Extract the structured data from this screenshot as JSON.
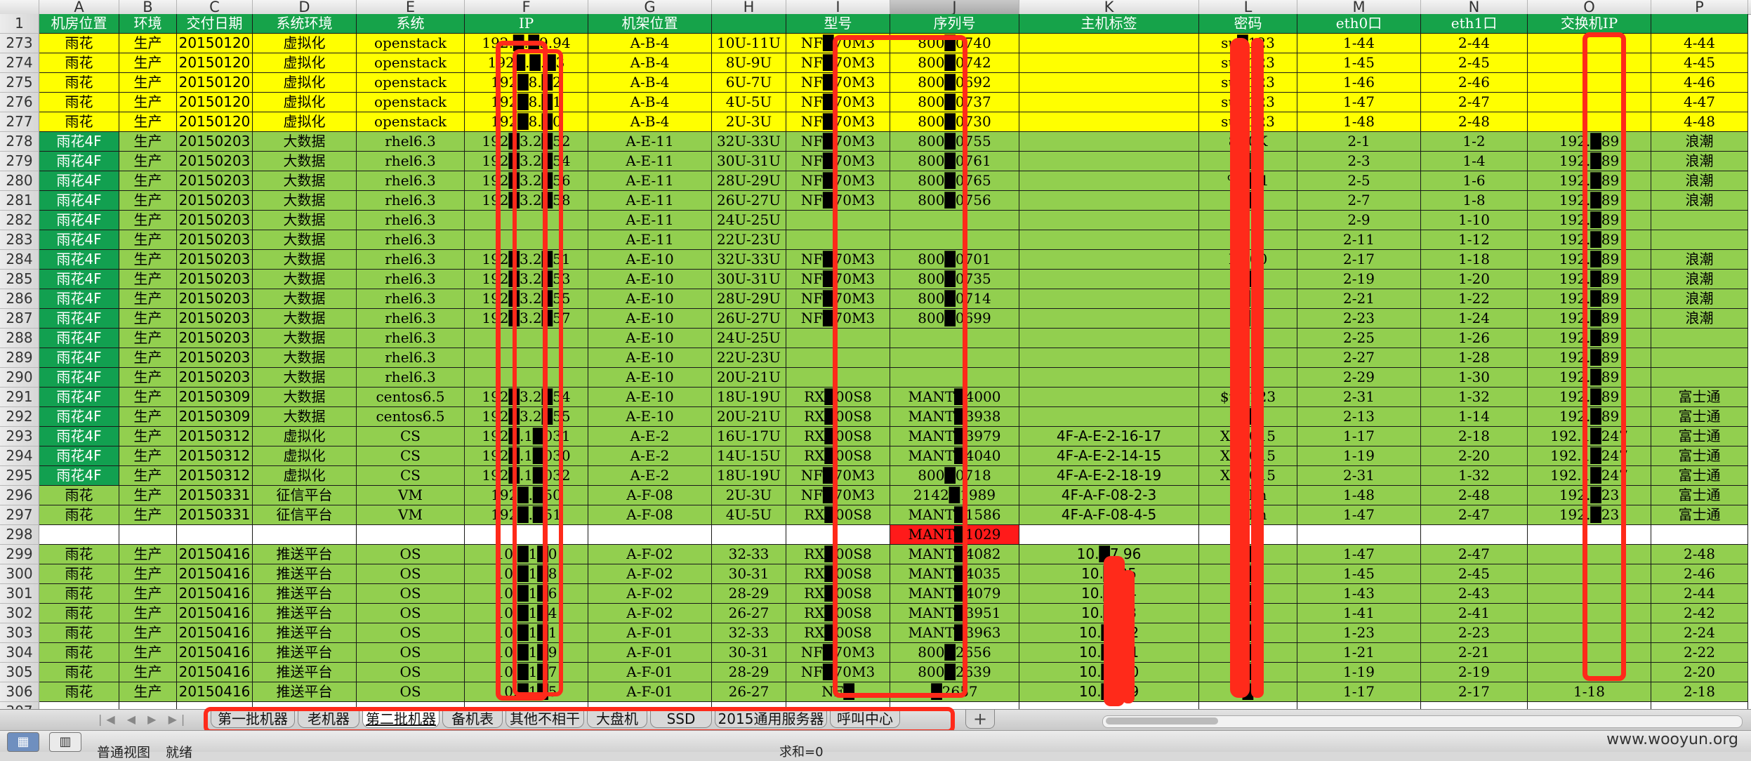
{
  "columns": [
    {
      "letter": "",
      "w": 56
    },
    {
      "letter": "A",
      "w": 114
    },
    {
      "letter": "B",
      "w": 82
    },
    {
      "letter": "C",
      "w": 108
    },
    {
      "letter": "D",
      "w": 148
    },
    {
      "letter": "E",
      "w": 154
    },
    {
      "letter": "F",
      "w": 176
    },
    {
      "letter": "G",
      "w": 176
    },
    {
      "letter": "H",
      "w": 106
    },
    {
      "letter": "I",
      "w": 148
    },
    {
      "letter": "J",
      "w": 184
    },
    {
      "letter": "K",
      "w": 256
    },
    {
      "letter": "L",
      "w": 140
    },
    {
      "letter": "M",
      "w": 176
    },
    {
      "letter": "N",
      "w": 152
    },
    {
      "letter": "O",
      "w": 176
    },
    {
      "letter": "P",
      "w": 138
    }
  ],
  "selected_column": "J",
  "rows": [
    {
      "n": "1",
      "style": "hdr",
      "cells": [
        "机房位置",
        "环境",
        "交付日期",
        "系统环境",
        "系统",
        "IP",
        "机架位置",
        "",
        "型号",
        "序列号",
        "主机标签",
        "密码",
        "eth0口",
        "eth1口",
        "交换机IP",
        ""
      ]
    },
    {
      "n": "273",
      "style": "yellow",
      "cells": [
        "雨花",
        "生产",
        "20150120",
        "虚拟化",
        "openstack",
        "192.█.█9.94",
        "A-B-4",
        "10U-11U",
        "NF█70M3",
        "800█0740",
        "",
        "su█123",
        "1-44",
        "2-44",
        "",
        "4-44"
      ]
    },
    {
      "n": "274",
      "style": "yellow",
      "cells": [
        "雨花",
        "生产",
        "20150120",
        "虚拟化",
        "openstack",
        "192█.█.█3",
        "A-B-4",
        "8U-9U",
        "NF█70M3",
        "800█0742",
        "",
        "su█123",
        "1-45",
        "2-45",
        "",
        "4-45"
      ]
    },
    {
      "n": "275",
      "style": "yellow",
      "cells": [
        "雨花",
        "生产",
        "20150120",
        "虚拟化",
        "openstack",
        "192█8.█2",
        "A-B-4",
        "6U-7U",
        "NF█70M3",
        "800█0692",
        "",
        "su█123",
        "1-46",
        "2-46",
        "",
        "4-46"
      ]
    },
    {
      "n": "276",
      "style": "yellow",
      "cells": [
        "雨花",
        "生产",
        "20150120",
        "虚拟化",
        "openstack",
        "192█8.█1",
        "A-B-4",
        "4U-5U",
        "NF█70M3",
        "800█0737",
        "",
        "su█123",
        "1-47",
        "2-47",
        "",
        "4-47"
      ]
    },
    {
      "n": "277",
      "style": "yellow",
      "cells": [
        "雨花",
        "生产",
        "20150120",
        "虚拟化",
        "openstack",
        "192█8.█0",
        "A-B-4",
        "2U-3U",
        "NF█70M3",
        "800█0730",
        "",
        "su█123",
        "1-48",
        "2-48",
        "",
        "4-48"
      ]
    },
    {
      "n": "278",
      "style": "green",
      "a": "dark",
      "cells": [
        "雨花4F",
        "生产",
        "20150203",
        "大数据",
        "rhel6.3",
        "192█3.2█52",
        "A-E-11",
        "32U-33U",
        "NF█70M3",
        "800█0755",
        "",
        "8█0K",
        "2-1",
        "1-2",
        "192.█89",
        "浪潮"
      ]
    },
    {
      "n": "279",
      "style": "green",
      "a": "dark",
      "cells": [
        "雨花4F",
        "生产",
        "20150203",
        "大数据",
        "rhel6.3",
        "192█3.2█54",
        "A-E-11",
        "30U-31U",
        "NF█70M3",
        "800█0761",
        "",
        ",█F",
        "2-3",
        "1-4",
        "192.█89",
        "浪潮"
      ]
    },
    {
      "n": "280",
      "style": "green",
      "a": "dark",
      "cells": [
        "雨花4F",
        "生产",
        "20150203",
        "大数据",
        "rhel6.3",
        "192█3.2█56",
        "A-E-11",
        "28U-29U",
        "NF█70M3",
        "800█0765",
        "",
        "%█01",
        "2-5",
        "1-6",
        "192.█89",
        "浪潮"
      ]
    },
    {
      "n": "281",
      "style": "green",
      "a": "dark",
      "cells": [
        "雨花4F",
        "生产",
        "20150203",
        "大数据",
        "rhel6.3",
        "192█3.2█58",
        "A-E-11",
        "26U-27U",
        "NF█70M3",
        "800█0756",
        "",
        "n█4",
        "2-7",
        "1-8",
        "192.█89",
        "浪潮"
      ]
    },
    {
      "n": "282",
      "style": "green",
      "a": "dark",
      "cells": [
        "雨花4F",
        "生产",
        "20150203",
        "大数据",
        "rhel6.3",
        "",
        "A-E-11",
        "24U-25U",
        "",
        "",
        "",
        "",
        "2-9",
        "1-10",
        "192.█89",
        ""
      ]
    },
    {
      "n": "283",
      "style": "green",
      "a": "dark",
      "cells": [
        "雨花4F",
        "生产",
        "20150203",
        "大数据",
        "rhel6.3",
        "",
        "A-E-11",
        "22U-23U",
        "",
        "",
        "",
        "",
        "2-11",
        "1-12",
        "192.█89",
        ""
      ]
    },
    {
      "n": "284",
      "style": "green",
      "a": "dark",
      "cells": [
        "雨花4F",
        "生产",
        "20150203",
        "大数据",
        "rhel6.3",
        "192█3.2█51",
        "A-E-10",
        "32U-33U",
        "NF█70M3",
        "800█0701",
        "",
        "E█00",
        "2-17",
        "1-18",
        "192.█89",
        "浪潮"
      ]
    },
    {
      "n": "285",
      "style": "green",
      "a": "dark",
      "cells": [
        "雨花4F",
        "生产",
        "20150203",
        "大数据",
        "rhel6.3",
        "192█3.2█53",
        "A-E-10",
        "30U-31U",
        "NF█70M3",
        "800█0735",
        "",
        "k█E",
        "2-19",
        "1-20",
        "192.█89",
        "浪潮"
      ]
    },
    {
      "n": "286",
      "style": "green",
      "a": "dark",
      "cells": [
        "雨花4F",
        "生产",
        "20150203",
        "大数据",
        "rhel6.3",
        "192█3.2█55",
        "A-E-10",
        "28U-29U",
        "NF█70M3",
        "800█0714",
        "",
        "(█~",
        "2-21",
        "1-22",
        "192.█89",
        "浪潮"
      ]
    },
    {
      "n": "287",
      "style": "green",
      "a": "dark",
      "cells": [
        "雨花4F",
        "生产",
        "20150203",
        "大数据",
        "rhel6.3",
        "192█3.2█57",
        "A-E-10",
        "26U-27U",
        "NF█70M3",
        "800█0699",
        "",
        ")█>",
        "2-23",
        "1-24",
        "192.█89",
        "浪潮"
      ]
    },
    {
      "n": "288",
      "style": "green",
      "a": "dark",
      "cells": [
        "雨花4F",
        "生产",
        "20150203",
        "大数据",
        "rhel6.3",
        "",
        "A-E-10",
        "24U-25U",
        "",
        "",
        "",
        "",
        "2-25",
        "1-26",
        "192.█89",
        ""
      ]
    },
    {
      "n": "289",
      "style": "green",
      "a": "dark",
      "cells": [
        "雨花4F",
        "生产",
        "20150203",
        "大数据",
        "rhel6.3",
        "",
        "A-E-10",
        "22U-23U",
        "",
        "",
        "",
        "",
        "2-27",
        "1-28",
        "192.█89",
        ""
      ]
    },
    {
      "n": "290",
      "style": "green",
      "a": "dark",
      "cells": [
        "雨花4F",
        "生产",
        "20150203",
        "大数据",
        "rhel6.3",
        "",
        "A-E-10",
        "20U-21U",
        "",
        "",
        "",
        "",
        "2-29",
        "1-30",
        "192.█89",
        ""
      ]
    },
    {
      "n": "291",
      "style": "green",
      "a": "dark",
      "cells": [
        "雨花4F",
        "生产",
        "20150309",
        "大数据",
        "centos6.5",
        "192█3.2█54",
        "A-E-10",
        "18U-19U",
        "RX█00S8",
        "MANT█4000",
        "",
        "$u█123",
        "2-31",
        "1-32",
        "192.█89",
        "富士通"
      ]
    },
    {
      "n": "292",
      "style": "green",
      "a": "dark",
      "cells": [
        "雨花4F",
        "生产",
        "20150309",
        "大数据",
        "centos6.5",
        "192█3.2█55",
        "A-E-10",
        "20U-21U",
        "RX█00S8",
        "MANT█3938",
        "",
        "9█9",
        "2-13",
        "1-14",
        "192.█89",
        "富士通"
      ]
    },
    {
      "n": "293",
      "style": "green",
      "a": "dark",
      "cells": [
        "雨花4F",
        "生产",
        "20150312",
        "虚拟化",
        "CS",
        "192█.1█031",
        "A-E-2",
        "16U-17U",
        "RX█00S8",
        "MANT█3979",
        "4F-A-E-2-16-17",
        "Xx█015",
        "1-17",
        "2-18",
        "192.1█247",
        "富士通"
      ]
    },
    {
      "n": "294",
      "style": "green",
      "a": "dark",
      "cells": [
        "雨花4F",
        "生产",
        "20150312",
        "虚拟化",
        "CS",
        "192█.1█030",
        "A-E-2",
        "14U-15U",
        "RX█00S8",
        "MANT█4040",
        "4F-A-E-2-14-15",
        "Xx█015",
        "1-19",
        "2-20",
        "192.1█247",
        "富士通"
      ]
    },
    {
      "n": "295",
      "style": "green",
      "a": "dark",
      "cells": [
        "雨花4F",
        "生产",
        "20150312",
        "虚拟化",
        "CS",
        "192█.1█032",
        "A-E-2",
        "18U-19U",
        "NF█70M3",
        "800█0718",
        "4F-A-E-2-18-19",
        "Xx█015",
        "2-31",
        "1-32",
        "192.1█247",
        "富士通"
      ]
    },
    {
      "n": "296",
      "style": "green",
      "cells": [
        "雨花",
        "生产",
        "20150331",
        "征信平台",
        "VM",
        "192█.█50",
        "A-F-08",
        "2U-3U",
        "NF█70M3",
        "2142█1989",
        "4F-A-F-08-2-3",
        "1█hn",
        "1-48",
        "2-48",
        "192.█23",
        "富士通"
      ]
    },
    {
      "n": "297",
      "style": "green",
      "cells": [
        "雨花",
        "生产",
        "20150331",
        "征信平台",
        "VM",
        "192█.█51",
        "A-F-08",
        "4U-5U",
        "RX█00S8",
        "MANT█1586",
        "4F-A-F-08-4-5",
        "1█hn",
        "1-47",
        "2-47",
        "192.█23",
        "富士通"
      ]
    },
    {
      "n": "298",
      "style": "white",
      "cells": [
        "",
        "",
        "",
        "",
        "",
        "",
        "",
        "",
        "",
        "MANT█1029",
        "",
        "",
        "",
        "",
        "",
        ""
      ]
    },
    {
      "n": "299",
      "style": "green",
      "cells": [
        "雨花",
        "生产",
        "20150416",
        "推送平台",
        "OS",
        "10.█1█0",
        "A-F-02",
        "32-33",
        "RX█00S8",
        "MANT█4082",
        "10.█7.96",
        "4█b",
        "1-47",
        "2-47",
        "",
        "2-48"
      ]
    },
    {
      "n": "300",
      "style": "green",
      "cells": [
        "雨花",
        "生产",
        "20150416",
        "推送平台",
        "OS",
        "10.█1█8",
        "A-F-02",
        "30-31",
        "RX█00S8",
        "MANT█4035",
        "10.█.95",
        "4█b",
        "1-45",
        "2-45",
        "",
        "2-46"
      ]
    },
    {
      "n": "301",
      "style": "green",
      "cells": [
        "雨花",
        "生产",
        "20150416",
        "推送平台",
        "OS",
        "10.█1█6",
        "A-F-02",
        "28-29",
        "RX█00S8",
        "MANT█4079",
        "10.█.94",
        "4█b",
        "1-43",
        "2-43",
        "",
        "2-44"
      ]
    },
    {
      "n": "302",
      "style": "green",
      "cells": [
        "雨花",
        "生产",
        "20150416",
        "推送平台",
        "OS",
        "10.█1█4",
        "A-F-02",
        "26-27",
        "RX█00S8",
        "MANT█3951",
        "10.█.93",
        "4█b",
        "1-41",
        "2-41",
        "",
        "2-42"
      ]
    },
    {
      "n": "303",
      "style": "green",
      "cells": [
        "雨花",
        "生产",
        "20150416",
        "推送平台",
        "OS",
        "10.█1█1",
        "A-F-01",
        "32-33",
        "RX█00S8",
        "MANT█3963",
        "10.█112",
        "4█b",
        "1-23",
        "2-23",
        "",
        "2-24"
      ]
    },
    {
      "n": "304",
      "style": "green",
      "cells": [
        "雨花",
        "生产",
        "20150416",
        "推送平台",
        "OS",
        "10.█1█9",
        "A-F-01",
        "30-31",
        "NF█70M3",
        "800█2656",
        "10.█111",
        "4█b",
        "1-21",
        "2-21",
        "",
        "2-22"
      ]
    },
    {
      "n": "305",
      "style": "green",
      "cells": [
        "雨花",
        "生产",
        "20150416",
        "推送平台",
        "OS",
        "10.█1█7",
        "A-F-01",
        "28-29",
        "NF█70M3",
        "800█2639",
        "10.█110",
        "4█b",
        "1-19",
        "2-19",
        "",
        "2-20"
      ]
    },
    {
      "n": "306",
      "style": "green",
      "cells": [
        "雨花",
        "生产",
        "20150416",
        "推送平台",
        "OS",
        "10.█1█5",
        "A-F-01",
        "26-27",
        "NF█",
        "█2657",
        "10.█109",
        "4█b",
        "1-17",
        "2-17",
        "1-18",
        "2-18"
      ]
    },
    {
      "n": "307",
      "style": "white",
      "cells": [
        "",
        "",
        "",
        "",
        "",
        "",
        "",
        "",
        "",
        "",
        "",
        "",
        "",
        "",
        "",
        ""
      ]
    }
  ],
  "sheet_tabs": [
    "第一批机器",
    "老机器",
    "第二批机器",
    "备机表",
    "其他不相干",
    "大盘机",
    "SSD",
    "2015通用服务器",
    "呼叫中心"
  ],
  "active_tab": "第二批机器",
  "tab_nav": "|◀ ◀ ▶ ▶|",
  "add_sheet": "+",
  "status": {
    "view_mode": "普通视图",
    "ready": "就绪",
    "sum_text": "求和=0"
  },
  "watermark": "www.wooyun.org",
  "colors": {
    "header_green": "#16a34a",
    "row_green": "#92cf4f",
    "row_yellow": "#ffff00",
    "a_dark_green": "#12a050",
    "redaction": "#ff2a1a",
    "highlight_red": "#ff1a1a"
  }
}
